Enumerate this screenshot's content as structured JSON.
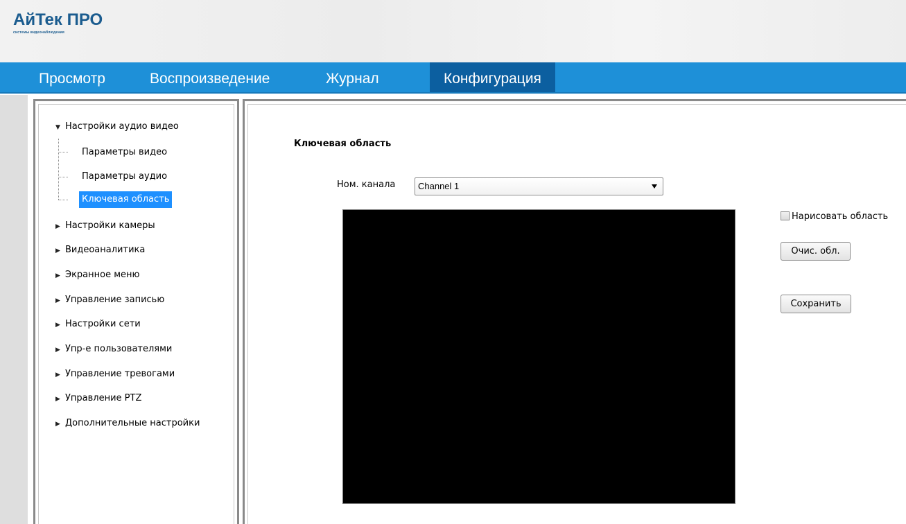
{
  "logo": {
    "title": "АйТек ПРО",
    "subtitle": "системы видеонаблюдения"
  },
  "nav": {
    "items": [
      {
        "label": "Просмотр"
      },
      {
        "label": "Воспроизведение"
      },
      {
        "label": "Журнал"
      },
      {
        "label": "Конфигурация",
        "active": true
      }
    ]
  },
  "sidebar": {
    "groups": [
      {
        "label": "Настройки аудио видео",
        "expanded": true,
        "children": [
          {
            "label": "Параметры видео"
          },
          {
            "label": "Параметры аудио"
          },
          {
            "label": "Ключевая область",
            "selected": true
          }
        ]
      },
      {
        "label": "Настройки камеры"
      },
      {
        "label": "Видеоаналитика"
      },
      {
        "label": "Экранное меню"
      },
      {
        "label": "Управление записью"
      },
      {
        "label": "Настройки сети"
      },
      {
        "label": "Упр-е пользователями"
      },
      {
        "label": "Управление тревогами"
      },
      {
        "label": "Управление PTZ"
      },
      {
        "label": "Дополнительные настройки"
      }
    ]
  },
  "main": {
    "title": "Ключевая область",
    "channel_label": "Ном. канала",
    "channel_value": "Channel 1",
    "draw_area_label": "Нарисовать область",
    "draw_area_checked": false,
    "clear_button": "Очис. обл.",
    "save_button": "Сохранить"
  },
  "colors": {
    "nav_bg": "#1e90d8",
    "nav_active": "#0c5fa0",
    "selection": "#1e90ff",
    "logo": "#1b5c8f"
  }
}
